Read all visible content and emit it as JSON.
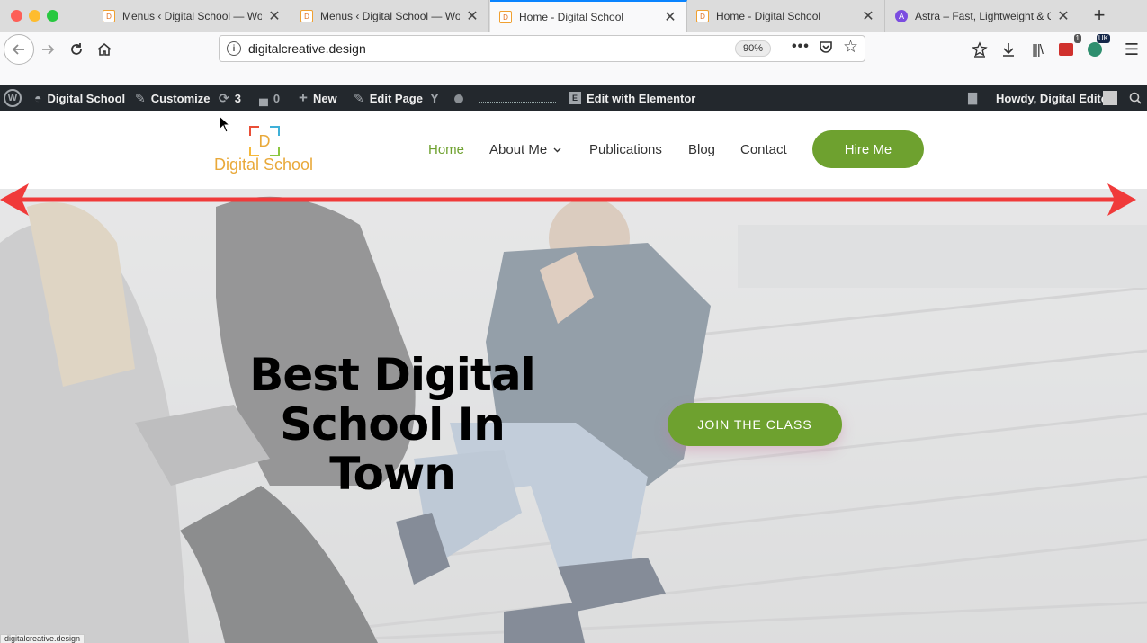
{
  "browser": {
    "tabs": [
      {
        "title": "Menus ‹ Digital School — Wor",
        "active": false
      },
      {
        "title": "Menus ‹ Digital School — Wor",
        "active": false
      },
      {
        "title": "Home - Digital School",
        "active": true
      },
      {
        "title": "Home - Digital School",
        "active": false
      },
      {
        "title": "Astra – Fast, Lightweight & Cu",
        "active": false
      }
    ],
    "url": "digitalcreative.design",
    "zoom": "90%",
    "toolbar_badges": {
      "extension_count": "1",
      "locale": "UK"
    },
    "status_text": "digitalcreative.design"
  },
  "adminbar": {
    "site_name": "Digital School",
    "customize": "Customize",
    "updates_count": "3",
    "comments_count": "0",
    "new_label": "New",
    "edit_page": "Edit Page",
    "elementor": "Edit with Elementor",
    "howdy": "Howdy, Digital Editor"
  },
  "site": {
    "logo_letter": "D",
    "logo_text": "Digital School",
    "menu": [
      {
        "label": "Home",
        "current": true
      },
      {
        "label": "About Me",
        "has_dropdown": true
      },
      {
        "label": "Publications"
      },
      {
        "label": "Blog"
      },
      {
        "label": "Contact"
      }
    ],
    "cta": "Hire Me"
  },
  "hero": {
    "title_lines": [
      "Best Digital",
      "School In",
      "Town"
    ],
    "button": "JOIN THE CLASS"
  },
  "colors": {
    "accent_green": "#6ea12f",
    "logo_orange": "#e9a93a",
    "annotation_red": "#f03a3a",
    "adminbar_bg": "#23282d"
  }
}
